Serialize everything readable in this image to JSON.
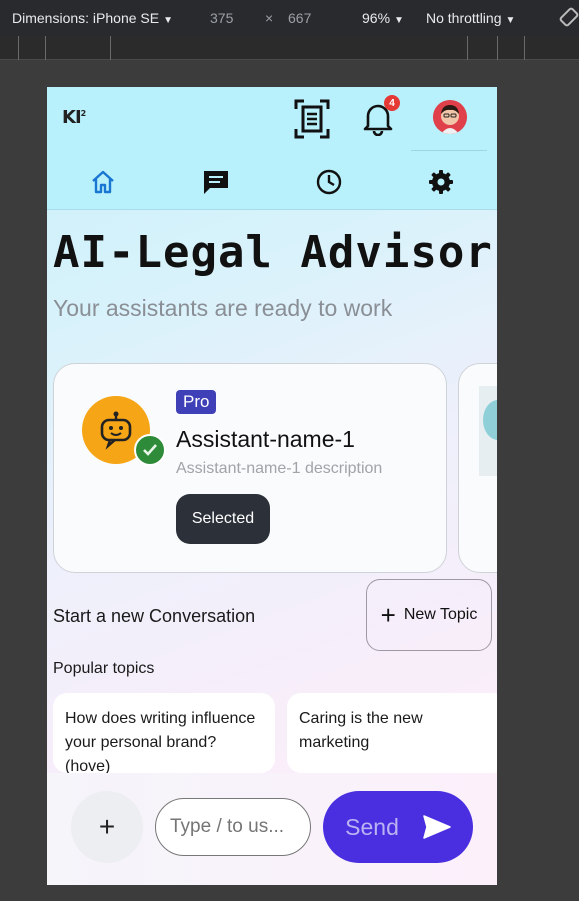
{
  "devtools": {
    "dimensions_label": "Dimensions: iPhone SE",
    "width": "375",
    "times": "×",
    "height": "667",
    "zoom": "96%",
    "throttling": "No throttling"
  },
  "header": {
    "logo": "KI",
    "logo_sup": "2",
    "notification_count": "4"
  },
  "nav": {
    "items": [
      {
        "name": "home",
        "icon": "home-icon"
      },
      {
        "name": "chat",
        "icon": "chat-icon"
      },
      {
        "name": "history",
        "icon": "clock-icon"
      },
      {
        "name": "settings",
        "icon": "gear-icon"
      }
    ]
  },
  "main": {
    "title": "AI-Legal Advisor",
    "subtitle": "Your assistants are ready to work"
  },
  "assistant": {
    "tier": "Pro",
    "name": "Assistant-name-1",
    "description": "Assistant-name-1 description",
    "selected_label": "Selected"
  },
  "conversation": {
    "start_label": "Start a new Conversation",
    "new_topic_label": "New Topic",
    "popular_label": "Popular topics",
    "topics": [
      "How does writing influence your personal brand? (hove)",
      "Caring is the new marketing"
    ]
  },
  "composer": {
    "placeholder": "Type / to us...",
    "send_label": "Send"
  },
  "colors": {
    "appbar": "#b8f0fb",
    "accent": "#4a2fe0",
    "pro_badge": "#3f3fb8",
    "badge": "#e53935"
  }
}
